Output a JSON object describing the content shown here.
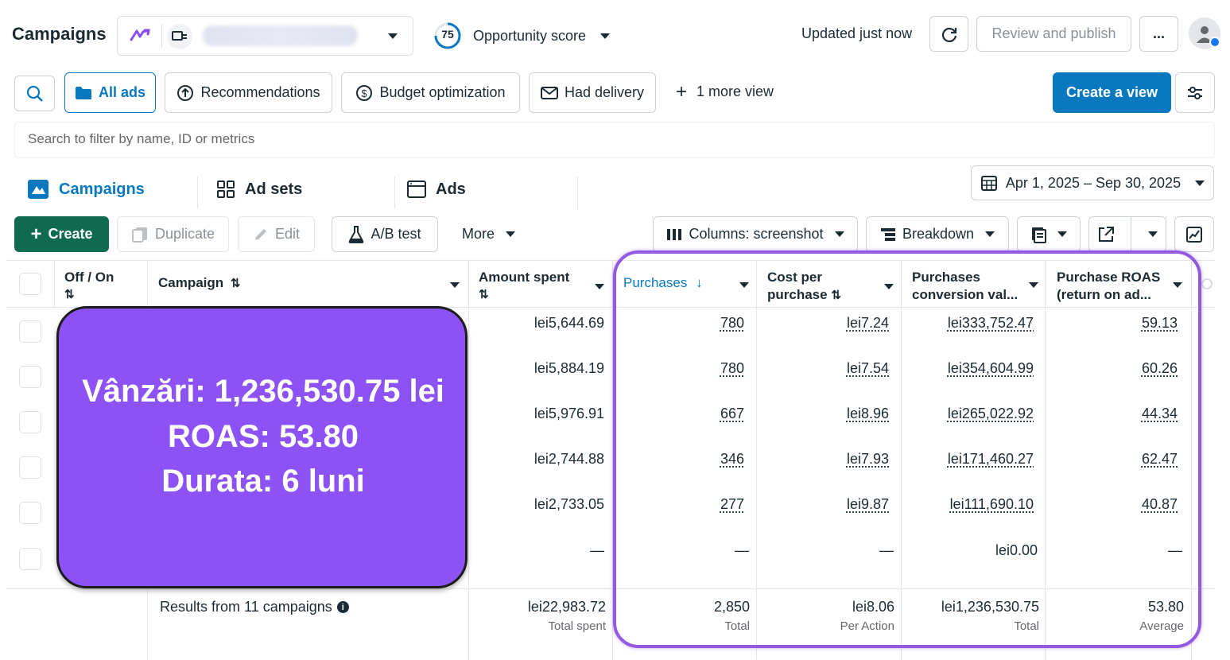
{
  "header": {
    "title": "Campaigns",
    "opportunity_score": "75",
    "opportunity_label": "Opportunity score",
    "updated_text": "Updated just now",
    "review_publish": "Review and publish",
    "more_label": "..."
  },
  "views": {
    "all_ads": "All ads",
    "recommendations": "Recommendations",
    "budget_optimization": "Budget optimization",
    "had_delivery": "Had delivery",
    "more_view": "1 more view",
    "create_view": "Create a view"
  },
  "search": {
    "placeholder": "Search to filter by name, ID or metrics"
  },
  "tabs": {
    "campaigns": "Campaigns",
    "ad_sets": "Ad sets",
    "ads": "Ads"
  },
  "date_range": "Apr 1, 2025 – Sep 30, 2025",
  "toolbar": {
    "create": "Create",
    "duplicate": "Duplicate",
    "edit": "Edit",
    "ab_test": "A/B test",
    "more": "More",
    "columns": "Columns: screenshot",
    "breakdown": "Breakdown"
  },
  "table": {
    "headers": {
      "off_on": "Off / On",
      "campaign": "Campaign",
      "amount_spent": "Amount spent",
      "purchases": "Purchases",
      "cost_per_purchase_1": "Cost per",
      "cost_per_purchase_2": "purchase",
      "conv_value_1": "Purchases",
      "conv_value_2": "conversion val...",
      "roas_1": "Purchase ROAS",
      "roas_2": "(return on ad..."
    },
    "rows": [
      {
        "spent": "lei5,644.69",
        "purchases": "780",
        "cpp": "lei7.24",
        "value": "lei333,752.47",
        "roas": "59.13"
      },
      {
        "spent": "lei5,884.19",
        "purchases": "780",
        "cpp": "lei7.54",
        "value": "lei354,604.99",
        "roas": "60.26"
      },
      {
        "spent": "lei5,976.91",
        "purchases": "667",
        "cpp": "lei8.96",
        "value": "lei265,022.92",
        "roas": "44.34"
      },
      {
        "spent": "lei2,744.88",
        "purchases": "346",
        "cpp": "lei7.93",
        "value": "lei171,460.27",
        "roas": "62.47"
      },
      {
        "spent": "lei2,733.05",
        "purchases": "277",
        "cpp": "lei9.87",
        "value": "lei111,690.10",
        "roas": "40.87"
      },
      {
        "spent": "—",
        "purchases": "—",
        "cpp": "—",
        "value": "lei0.00",
        "roas": "—"
      }
    ],
    "totals": {
      "label": "Results from 11 campaigns",
      "spent": "lei22,983.72",
      "spent_sub": "Total spent",
      "purchases": "2,850",
      "purchases_sub": "Total",
      "cpp": "lei8.06",
      "cpp_sub": "Per Action",
      "value": "lei1,236,530.75",
      "value_sub": "Total",
      "roas": "53.80",
      "roas_sub": "Average"
    }
  },
  "overlay": {
    "line1": "Vânzări: 1,236,530.75 lei",
    "line2": "ROAS: 53.80",
    "line3": "Durata: 6 luni"
  },
  "colors": {
    "primary_blue": "#0a78be",
    "create_green": "#0f6b4f",
    "overlay_purple": "#8c52f5",
    "highlight": "#9359e0"
  }
}
